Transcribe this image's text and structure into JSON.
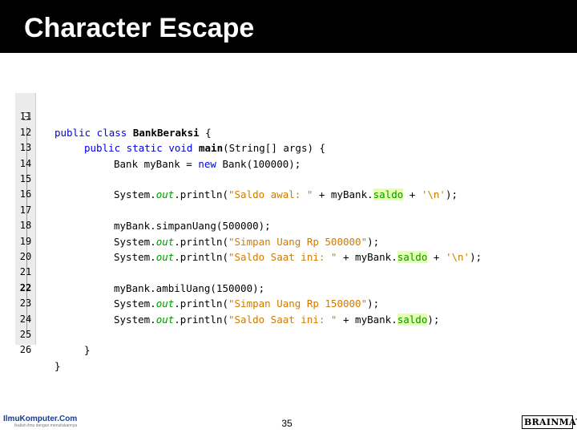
{
  "slide": {
    "title": "Character Escape",
    "page_number": "35"
  },
  "editor": {
    "lines": [
      {
        "n": "11"
      },
      {
        "n": "12"
      },
      {
        "n": "13"
      },
      {
        "n": "14"
      },
      {
        "n": "15"
      },
      {
        "n": "16"
      },
      {
        "n": "17"
      },
      {
        "n": "18"
      },
      {
        "n": "19"
      },
      {
        "n": "20"
      },
      {
        "n": "21"
      },
      {
        "n": "22"
      },
      {
        "n": "23"
      },
      {
        "n": "24"
      },
      {
        "n": "25"
      },
      {
        "n": "26"
      }
    ],
    "code": {
      "l11_kw": "public class",
      "l11_name": " BankBeraksi",
      "l11_rest": " {",
      "l12_kw": "public static void",
      "l12_name": " main",
      "l12_rest": "(String[] args) {",
      "l13_a": "Bank myBank = ",
      "l13_kw": "new",
      "l13_b": " Bank(100000);",
      "l15_a": "System.",
      "l15_out": "out",
      "l15_b": ".println(",
      "l15_str": "\"Saldo awal: \"",
      "l15_c": " + myBank.",
      "l15_fld": "saldo",
      "l15_d": " + ",
      "l15_str2": "'\\n'",
      "l15_e": ");",
      "l17": "myBank.simpanUang(500000);",
      "l18_a": "System.",
      "l18_out": "out",
      "l18_b": ".println(",
      "l18_str": "\"Simpan Uang Rp 500000\"",
      "l18_c": ");",
      "l19_a": "System.",
      "l19_out": "out",
      "l19_b": ".println(",
      "l19_str": "\"Saldo Saat ini: \"",
      "l19_c": " + myBank.",
      "l19_fld": "saldo",
      "l19_d": " + ",
      "l19_str2": "'\\n'",
      "l19_e": ");",
      "l21": "myBank.ambilUang(150000);",
      "l22_a": "System.",
      "l22_out": "out",
      "l22_b": ".println(",
      "l22_str": "\"Simpan Uang Rp 150000\"",
      "l22_c": ");",
      "l23_a": "System.",
      "l23_out": "out",
      "l23_b": ".println(",
      "l23_str": "\"Saldo Saat ini: \"",
      "l23_c": " + myBank.",
      "l23_fld": "saldo",
      "l23_e": ");",
      "l25": "}",
      "l26": "}"
    }
  },
  "footer": {
    "left_logo": "IlmuKomputer.Com",
    "left_logo_tagline": "Ikatlah ilmu dengan menuliskannya",
    "right_logo": "BRAINMATICS"
  },
  "colors": {
    "keyword": "#0000e6",
    "string": "#ce7b00",
    "field": "#009900",
    "field_highlight": "#e6ffad",
    "title_bar": "#000000"
  }
}
